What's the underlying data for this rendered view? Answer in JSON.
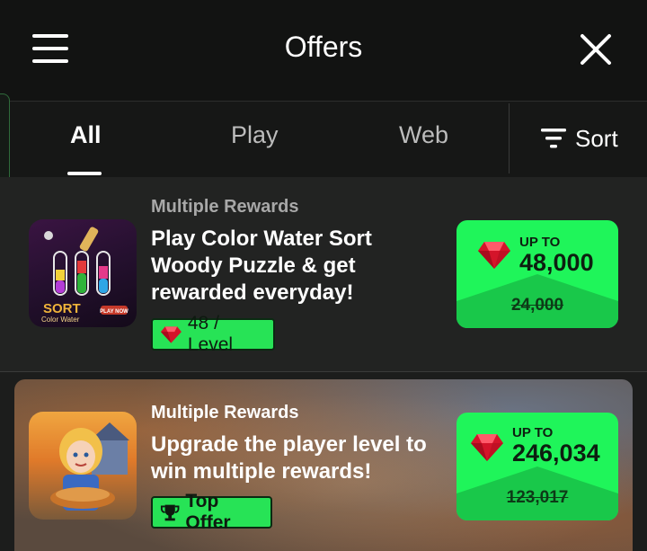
{
  "header": {
    "title": "Offers",
    "menu_icon": "hamburger-menu-icon",
    "close_icon": "close-icon"
  },
  "tabs": [
    {
      "label": "All",
      "active": true
    },
    {
      "label": "Play",
      "active": false
    },
    {
      "label": "Web",
      "active": false
    }
  ],
  "sort": {
    "label": "Sort",
    "icon": "sort-filter-icon"
  },
  "offers": [
    {
      "category": "Multiple Rewards",
      "description_lines": [
        "Play Color Water Sort",
        "Woody Puzzle & get",
        "rewarded everyday!"
      ],
      "thumbnail_text": [
        "SORT",
        "Color Water",
        "PLAY NOW"
      ],
      "badge": {
        "icon": "ruby-gem-icon",
        "text": "48 / Level"
      },
      "reward": {
        "prefix": "UP TO",
        "amount": "48,000",
        "original": "24,000",
        "icon": "ruby-gem-icon"
      }
    },
    {
      "category": "Multiple Rewards",
      "description_lines": [
        "Upgrade the player level to",
        "win multiple rewards!"
      ],
      "badge": {
        "icon": "trophy-icon",
        "text": "Top Offer"
      },
      "reward": {
        "prefix": "UP TO",
        "amount": "246,034",
        "original": "123,017",
        "icon": "ruby-gem-icon"
      }
    }
  ],
  "colors": {
    "accent_green": "#1ff55a",
    "background": "#1c1d1c",
    "header": "#121312"
  }
}
